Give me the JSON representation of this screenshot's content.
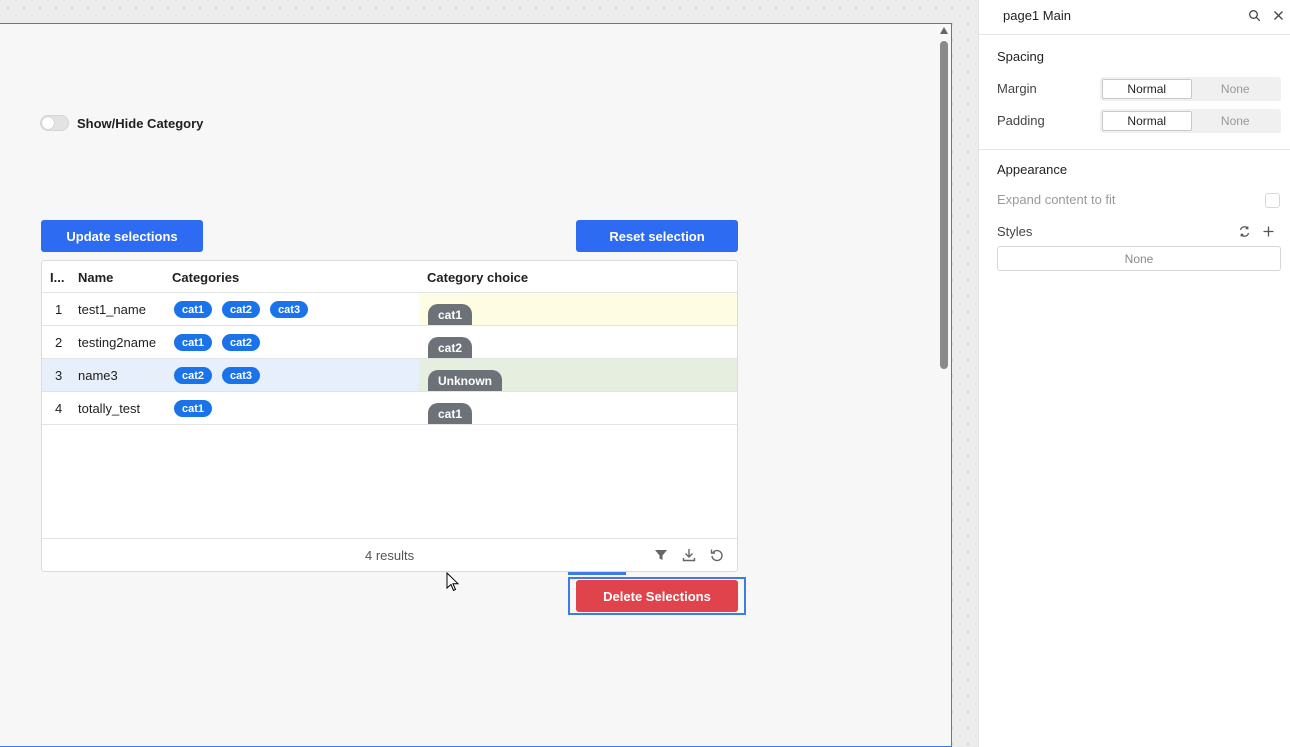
{
  "canvas": {
    "toggle_label": "Show/Hide Category",
    "update_button": "Update selections",
    "reset_button": "Reset selection",
    "delete_button": "Delete Selections"
  },
  "table": {
    "headers": [
      "I...",
      "Name",
      "Categories",
      "Category choice"
    ],
    "rows": [
      {
        "index": "1",
        "name": "test1_name",
        "categories": [
          "cat1",
          "cat2",
          "cat3"
        ],
        "choice": "cat1",
        "choice_style": "yellow"
      },
      {
        "index": "2",
        "name": "testing2name",
        "categories": [
          "cat1",
          "cat2"
        ],
        "choice": "cat2",
        "choice_style": "plain"
      },
      {
        "index": "3",
        "name": "name3",
        "categories": [
          "cat2",
          "cat3"
        ],
        "choice": "Unknown",
        "choice_style": "green"
      },
      {
        "index": "4",
        "name": "totally_test",
        "categories": [
          "cat1"
        ],
        "choice": "cat1",
        "choice_style": "plain"
      }
    ],
    "results": "4 results",
    "footer_icons": [
      "filter-icon",
      "download-icon",
      "refresh-icon"
    ]
  },
  "panel": {
    "title": "page1 Main",
    "spacing_title": "Spacing",
    "margin_label": "Margin",
    "padding_label": "Padding",
    "seg_normal": "Normal",
    "seg_none": "None",
    "appearance_title": "Appearance",
    "expand_label": "Expand content to fit",
    "styles_label": "Styles",
    "styles_value": "None"
  },
  "colors": {
    "primary": "#2c6bf2",
    "danger": "#e0434b",
    "pill": "#1a73e8",
    "chip": "#6c7278",
    "selection_outline": "#3d7be8"
  }
}
